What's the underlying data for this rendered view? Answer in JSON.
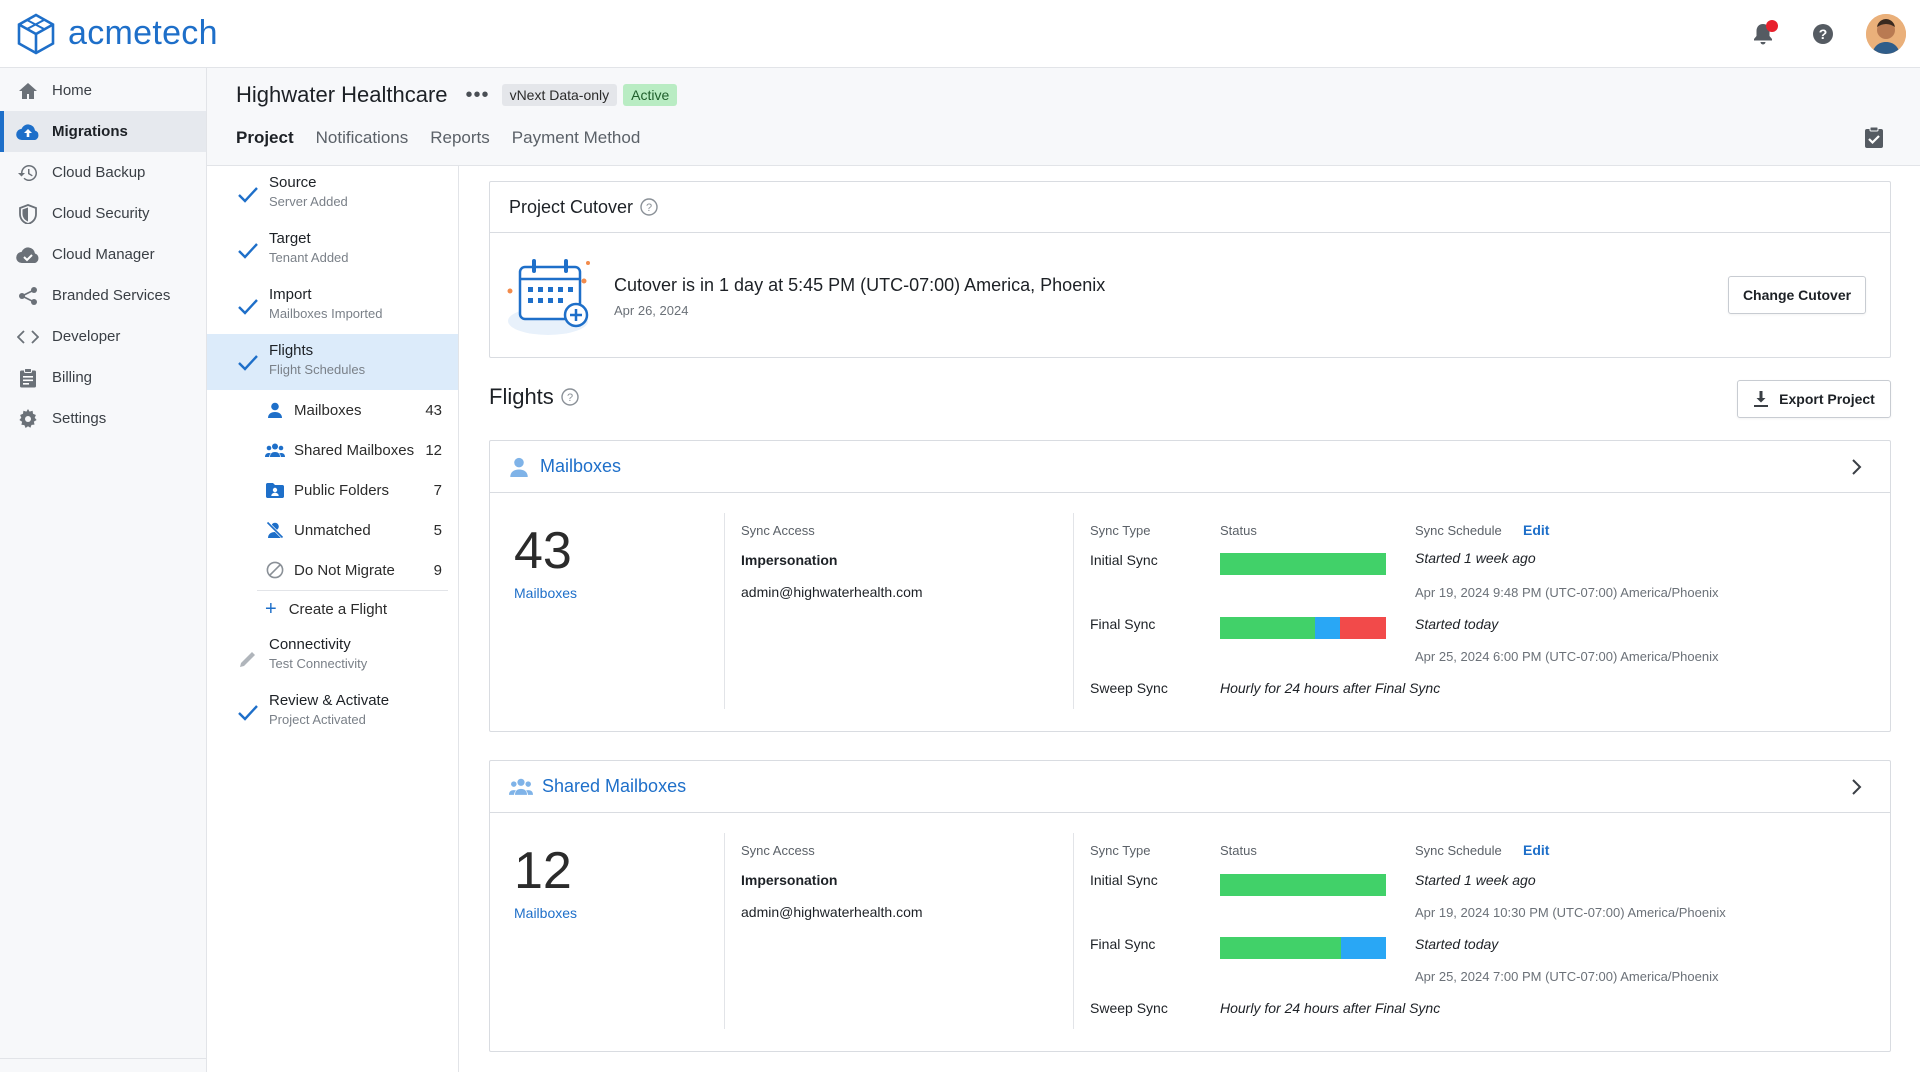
{
  "app": {
    "logo_text": "acmetech"
  },
  "colors": {
    "accent": "#1e6fc9",
    "bar_green": "#41d169",
    "bar_blue": "#29a7f5",
    "bar_red": "#f24a4a",
    "notification_dot": "#e8202c"
  },
  "nav": {
    "items": [
      {
        "label": "Home",
        "icon": "home-icon"
      },
      {
        "label": "Migrations",
        "icon": "cloud-upload-icon"
      },
      {
        "label": "Cloud Backup",
        "icon": "history-icon"
      },
      {
        "label": "Cloud Security",
        "icon": "shield-icon"
      },
      {
        "label": "Cloud Manager",
        "icon": "cloud-check-icon"
      },
      {
        "label": "Branded Services",
        "icon": "share-icon"
      },
      {
        "label": "Developer",
        "icon": "code-icon"
      },
      {
        "label": "Billing",
        "icon": "clipboard-icon"
      },
      {
        "label": "Settings",
        "icon": "gear-icon"
      }
    ]
  },
  "header": {
    "title": "Highwater Healthcare",
    "more": "•••",
    "badge_type": "vNext Data-only",
    "badge_status": "Active",
    "tabs": [
      "Project",
      "Notifications",
      "Reports",
      "Payment Method"
    ]
  },
  "steps": {
    "source": {
      "title": "Source",
      "sub": "Server Added"
    },
    "target": {
      "title": "Target",
      "sub": "Tenant Added"
    },
    "import": {
      "title": "Import",
      "sub": "Mailboxes Imported"
    },
    "flights": {
      "title": "Flights",
      "sub": "Flight Schedules"
    },
    "sub_items": [
      {
        "label": "Mailboxes",
        "count": "43",
        "icon": "user-icon"
      },
      {
        "label": "Shared Mailboxes",
        "count": "12",
        "icon": "users-icon"
      },
      {
        "label": "Public Folders",
        "count": "7",
        "icon": "folder-user-icon"
      },
      {
        "label": "Unmatched",
        "count": "5",
        "icon": "user-off-icon"
      },
      {
        "label": "Do Not Migrate",
        "count": "9",
        "icon": "block-icon"
      }
    ],
    "create_flight": "Create a Flight",
    "connectivity": {
      "title": "Connectivity",
      "sub": "Test Connectivity"
    },
    "review": {
      "title": "Review & Activate",
      "sub": "Project Activated"
    }
  },
  "cutover": {
    "title": "Project Cutover",
    "message": "Cutover is in 1 day at 5:45 PM (UTC-07:00) America, Phoenix",
    "date": "Apr 26, 2024",
    "button": "Change Cutover"
  },
  "flights": {
    "title": "Flights",
    "export_button": "Export Project",
    "labels": {
      "sync_access": "Sync Access",
      "sync_type": "Sync Type",
      "status": "Status",
      "sync_schedule": "Sync Schedule",
      "edit": "Edit",
      "initial": "Initial Sync",
      "final": "Final Sync",
      "sweep": "Sweep Sync"
    },
    "cards": [
      {
        "title": "Mailboxes",
        "count": "43",
        "count_label": "Mailboxes",
        "access_method": "Impersonation",
        "access_account": "admin@highwaterhealth.com",
        "initial_status": {
          "complete": 1.0,
          "in_progress": 0.0,
          "failed": 0.0
        },
        "initial_text": "Started 1 week ago",
        "initial_time": "Apr 19, 2024 9:48 PM (UTC-07:00) America/Phoenix",
        "final_status": {
          "complete": 0.57,
          "in_progress": 0.15,
          "failed": 0.28
        },
        "final_text": "Started today",
        "final_time": "Apr 25, 2024  6:00 PM (UTC-07:00) America/Phoenix",
        "sweep_text": "Hourly for 24 hours after Final Sync"
      },
      {
        "title": "Shared Mailboxes",
        "count": "12",
        "count_label": "Mailboxes",
        "access_method": "Impersonation",
        "access_account": "admin@highwaterhealth.com",
        "initial_status": {
          "complete": 1.0,
          "in_progress": 0.0,
          "failed": 0.0
        },
        "initial_text": "Started 1 week ago",
        "initial_time": "Apr 19, 2024 10:30 PM (UTC-07:00) America/Phoenix",
        "final_status": {
          "complete": 0.73,
          "in_progress": 0.27,
          "failed": 0.0
        },
        "final_text": "Started today",
        "final_time": "Apr 25, 2024 7:00 PM (UTC-07:00) America/Phoenix",
        "sweep_text": "Hourly for 24 hours after Final Sync"
      }
    ]
  }
}
